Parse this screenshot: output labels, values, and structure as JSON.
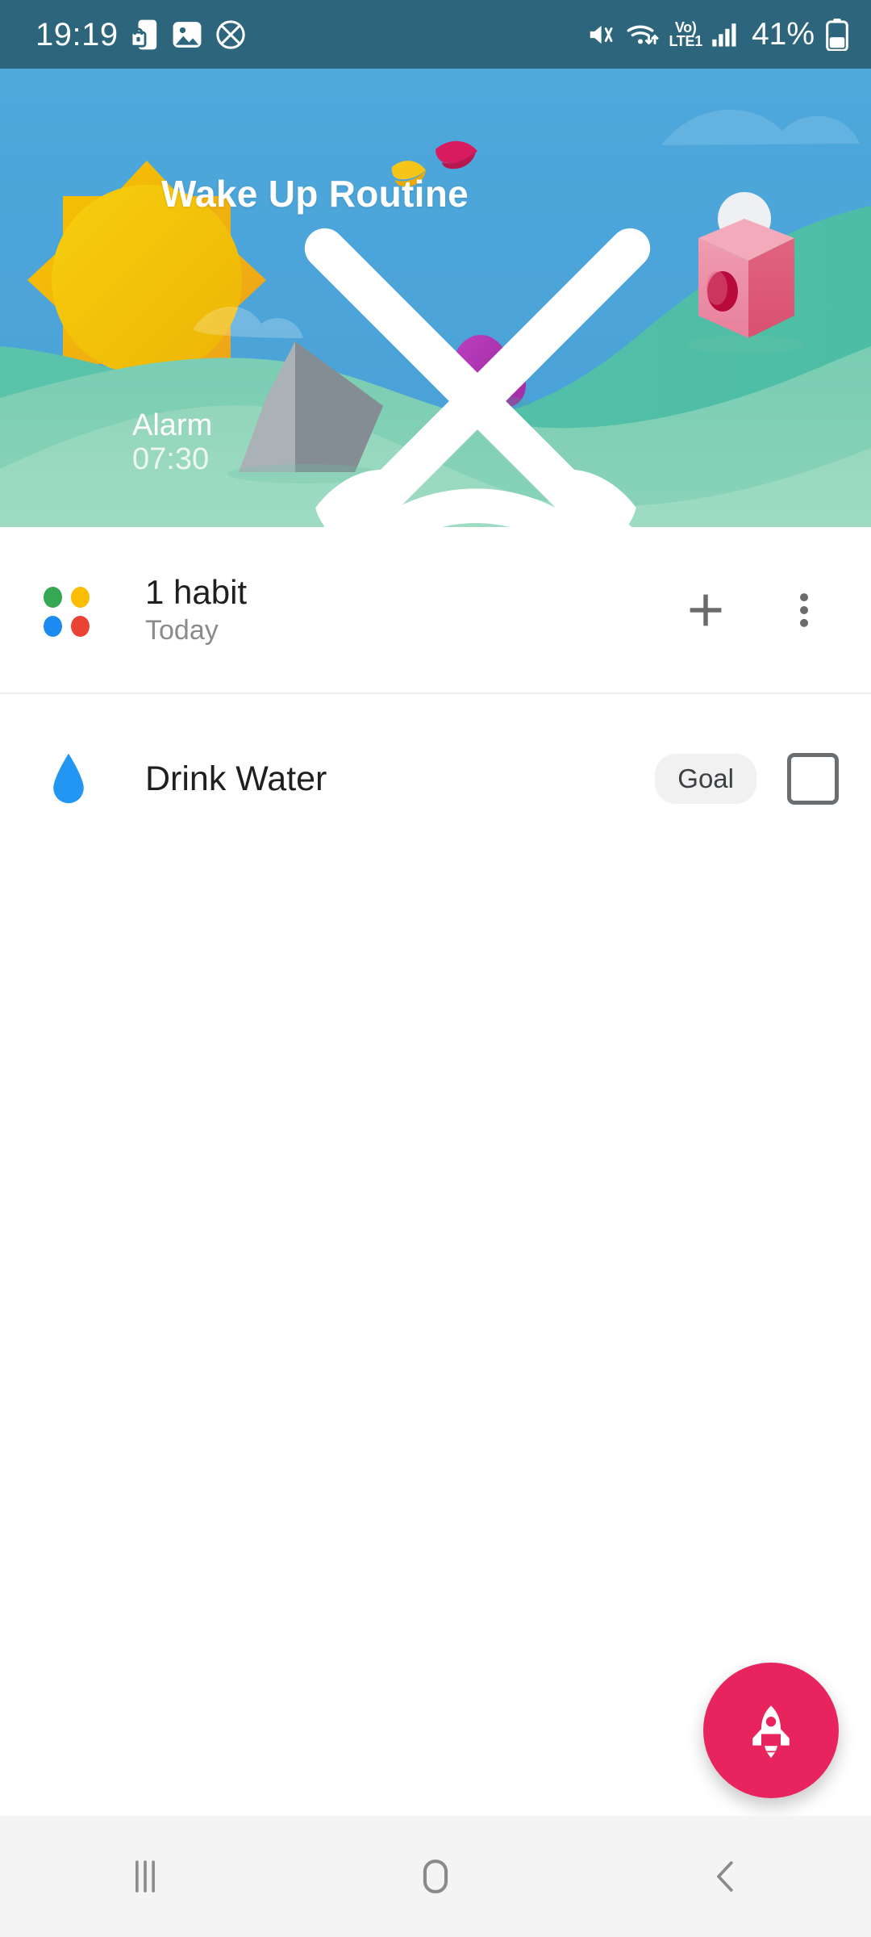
{
  "status_bar": {
    "time": "19:19",
    "battery_percent": "41%",
    "network_label_top": "Vo)",
    "network_label_bottom": "LTE1",
    "left_icons": [
      "phone-lock-icon",
      "image-icon",
      "no-ads-icon"
    ],
    "right_icons": [
      "mute-icon",
      "wifi-icon",
      "volte-icon",
      "signal-icon",
      "battery-icon"
    ],
    "background_color": "#2d657d"
  },
  "hero": {
    "title": "Wake Up Routine",
    "close_icon": "close-icon",
    "alarm": {
      "icon": "alarm-clock-icon",
      "label": "Alarm",
      "time": "07:30"
    },
    "scene": {
      "sky_color": "#4aa3d8",
      "hill_far_color": "#55bfa8",
      "hill_mid_color": "#74c9ae",
      "hill_near_color": "#8ed4b9",
      "sun_color": "#f2c200",
      "sun_accent_color": "#f0a227",
      "birdhouse_color": "#e8849d",
      "bush_color": "#b33bb5",
      "pyramid_color": "#9aa2a8",
      "bird_yellow_color": "#f5c518",
      "bird_pink_color": "#d81b5f"
    }
  },
  "habit_group": {
    "icon": "four-dots-icon",
    "title": "1 habit",
    "subtitle": "Today",
    "add_icon": "plus-icon",
    "menu_icon": "more-vertical-icon",
    "dot_colors": {
      "green": "#34a853",
      "yellow": "#fbbc04",
      "blue": "#1a8bf0",
      "red": "#ea4335"
    }
  },
  "habits": [
    {
      "icon": "water-drop-icon",
      "name": "Drink Water",
      "badge": "Goal",
      "checked": false,
      "icon_color": "#2196f3"
    }
  ],
  "fab": {
    "icon": "rocket-icon",
    "color": "#e8245e"
  },
  "nav_bar": {
    "recents_icon": "recents-icon",
    "home_icon": "home-icon",
    "back_icon": "back-icon",
    "background_color": "#f4f4f4"
  }
}
